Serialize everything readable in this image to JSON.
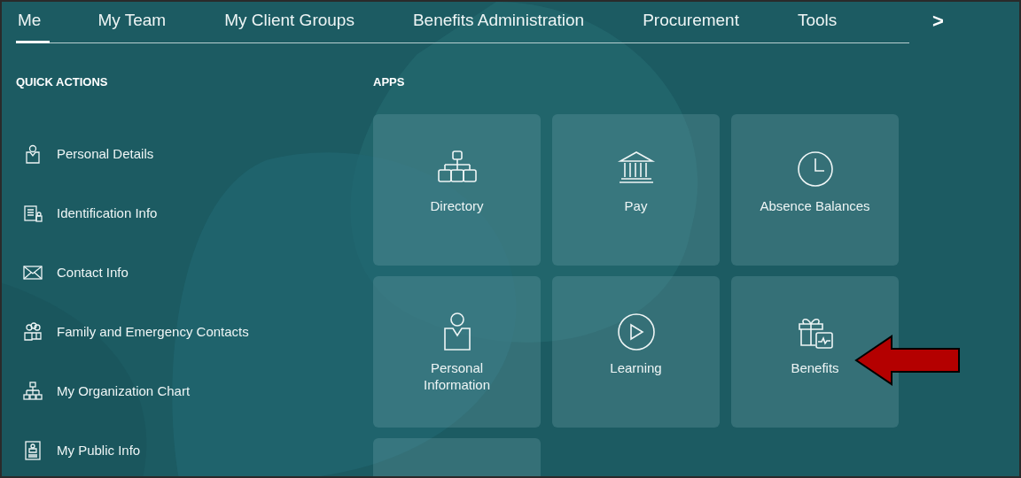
{
  "tabs": [
    {
      "label": "Me",
      "selected": true
    },
    {
      "label": "My Team",
      "selected": false
    },
    {
      "label": "My Client Groups",
      "selected": false
    },
    {
      "label": "Benefits Administration",
      "selected": false
    },
    {
      "label": "Procurement",
      "selected": false
    },
    {
      "label": "Tools",
      "selected": false
    }
  ],
  "more_tabs": ">",
  "quick_actions": {
    "title": "QUICK ACTIONS",
    "items": [
      {
        "label": "Personal Details"
      },
      {
        "label": "Identification Info"
      },
      {
        "label": "Contact Info"
      },
      {
        "label": "Family and Emergency Contacts"
      },
      {
        "label": "My Organization Chart"
      },
      {
        "label": "My Public Info"
      }
    ]
  },
  "apps": {
    "title": "APPS",
    "tiles": [
      {
        "kind": "app",
        "label": "Directory"
      },
      {
        "kind": "app",
        "label": "Pay"
      },
      {
        "kind": "app",
        "label": "Absence Balances"
      },
      {
        "kind": "app",
        "label": "Personal Information"
      },
      {
        "kind": "app",
        "label": "Learning"
      },
      {
        "kind": "app",
        "label": "Benefits"
      },
      {
        "kind": "partial"
      }
    ]
  },
  "callout_arrow": {
    "kind": "left-arrow"
  }
}
